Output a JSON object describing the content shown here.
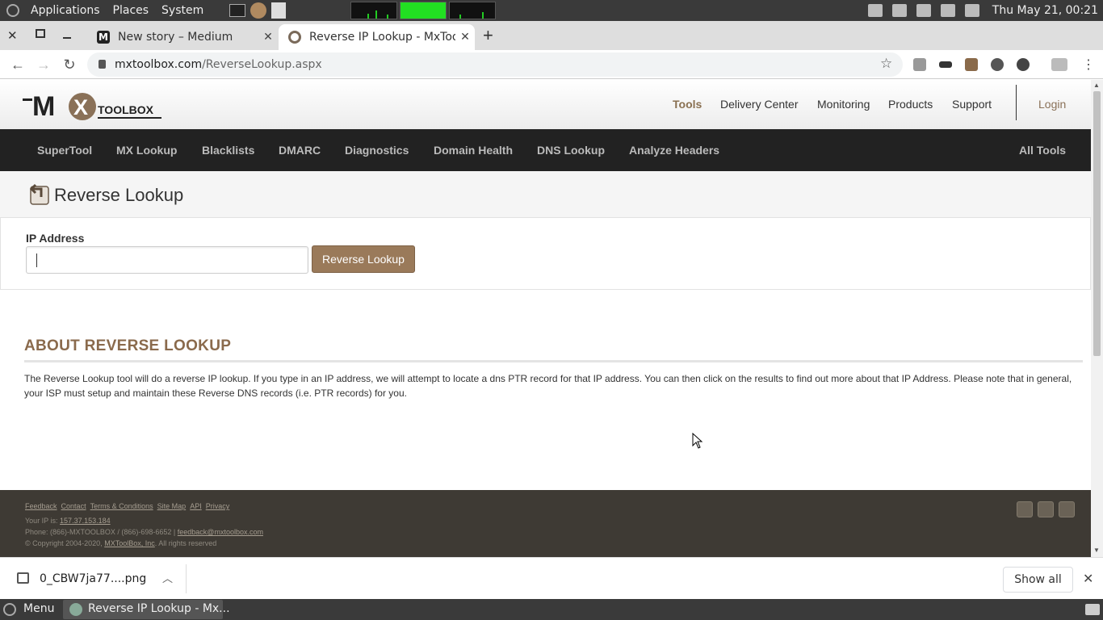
{
  "top_panel": {
    "menus": [
      "Applications",
      "Places",
      "System"
    ],
    "clock": "Thu May 21, 00:21"
  },
  "tabs": [
    {
      "title": "New story – Medium",
      "active": false
    },
    {
      "title": "Reverse IP Lookup - MxToolbox",
      "active": true
    }
  ],
  "address_bar": {
    "domain": "mxtoolbox.com",
    "path": "/ReverseLookup.aspx"
  },
  "site": {
    "logo_text": "MXTOOLBOX",
    "top_nav": [
      "Tools",
      "Delivery Center",
      "Monitoring",
      "Products",
      "Support"
    ],
    "login": "Login",
    "nav": [
      "SuperTool",
      "MX Lookup",
      "Blacklists",
      "DMARC",
      "Diagnostics",
      "Domain Health",
      "DNS Lookup",
      "Analyze Headers"
    ],
    "all_tools": "All Tools",
    "page_title": "Reverse Lookup",
    "form": {
      "label": "IP Address",
      "value": "",
      "button": "Reverse Lookup"
    },
    "about": {
      "title": "ABOUT REVERSE LOOKUP",
      "text": "The Reverse Lookup tool will do a reverse IP lookup. If you type in an IP address, we will attempt to locate a dns PTR record for that IP address. You can then click on the results to find out more about that IP Address. Please note that in general, your ISP must setup and maintain these Reverse DNS records (i.e. PTR records) for you."
    },
    "footer": {
      "links": [
        "Feedback",
        "Contact",
        "Terms & Conditions",
        "Site Map",
        "API",
        "Privacy"
      ],
      "ip_label": "Your IP is:",
      "ip": "157.37.153.184",
      "phone": "Phone: (866)-MXTOOLBOX / (866)-698-6652 |",
      "email": "feedback@mxtoolbox.com",
      "copyright": "© Copyright 2004-2020,",
      "company": "MXToolBox, Inc",
      "rights": ". All rights reserved"
    }
  },
  "downloads": {
    "file": "0_CBW7ja77....png",
    "show_all": "Show all"
  },
  "bottom_panel": {
    "menu": "Menu",
    "task": "Reverse IP Lookup - Mx..."
  }
}
